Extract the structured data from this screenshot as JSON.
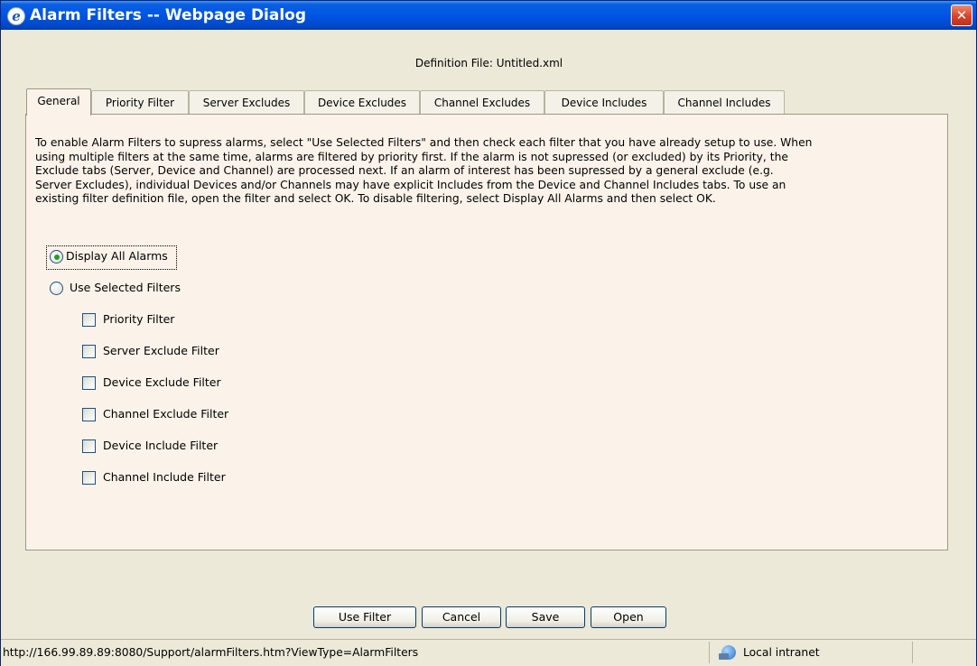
{
  "window": {
    "title": "Alarm Filters -- Webpage Dialog",
    "close_symbol": "✕",
    "icon": "ie-icon"
  },
  "definition_file": "Definition File: Untitled.xml",
  "tabs": [
    {
      "label": "General",
      "active": true
    },
    {
      "label": "Priority Filter",
      "active": false
    },
    {
      "label": "Server Excludes",
      "active": false
    },
    {
      "label": "Device Excludes",
      "active": false
    },
    {
      "label": "Channel Excludes",
      "active": false
    },
    {
      "label": "Device Includes",
      "active": false
    },
    {
      "label": "Channel Includes",
      "active": false
    }
  ],
  "general": {
    "description_lines": [
      "To enable Alarm Filters to supress alarms, select \"Use Selected Filters\" and then check each filter that you have already setup to use. When",
      "using multiple filters at the same time, alarms are filtered by priority first. If the alarm is not supressed (or excluded) by its Priority, the",
      "Exclude tabs (Server, Device and Channel) are processed next. If an alarm of interest has been supressed by a general exclude (e.g.",
      "Server Excludes), individual Devices and/or Channels may have explicit Includes from the Device and Channel Includes tabs. To use an",
      "existing filter definition file, open the filter and select OK. To disable filtering, select Display All Alarms and then select OK."
    ],
    "mode_options": [
      {
        "label": "Display All Alarms",
        "checked": true
      },
      {
        "label": "Use Selected Filters",
        "checked": false
      }
    ],
    "filters": [
      {
        "label": "Priority Filter",
        "checked": false
      },
      {
        "label": "Server Exclude Filter",
        "checked": false
      },
      {
        "label": "Device Exclude Filter",
        "checked": false
      },
      {
        "label": "Channel Exclude Filter",
        "checked": false
      },
      {
        "label": "Device Include Filter",
        "checked": false
      },
      {
        "label": "Channel Include Filter",
        "checked": false
      }
    ]
  },
  "buttons": {
    "use_filter": "Use Filter",
    "cancel": "Cancel",
    "save": "Save",
    "open": "Open"
  },
  "statusbar": {
    "url": "http://166.99.89.89:8080/Support/alarmFilters.htm?ViewType=AlarmFilters",
    "zone": "Local intranet",
    "zone_icon": "globe-network-icon"
  }
}
